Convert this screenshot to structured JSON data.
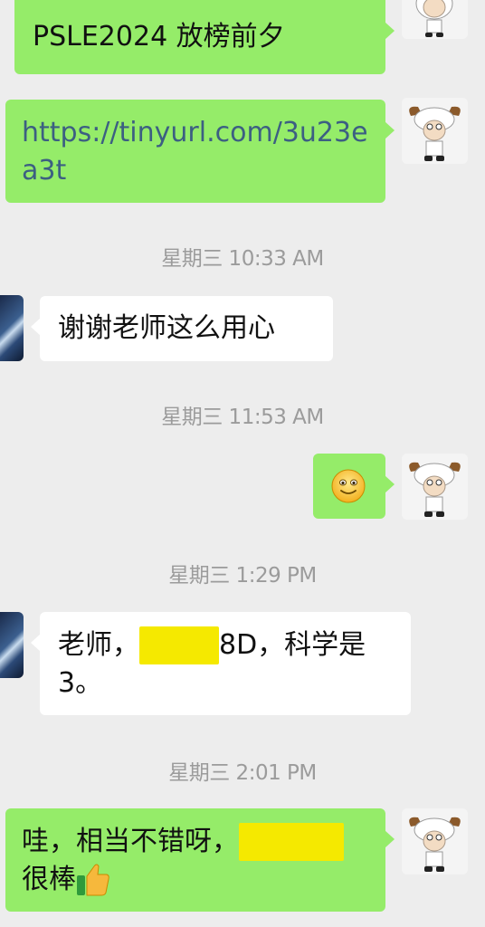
{
  "messages": [
    {
      "id": "m1",
      "text_visible": "PSLE2024 放榜前夕"
    },
    {
      "id": "m2",
      "link_line1": "https://tinyurl.com/3u23e",
      "link_line2": "a3t"
    },
    {
      "id": "t1",
      "timestamp": "星期三 10:33 AM"
    },
    {
      "id": "m3",
      "text": "谢谢老师这么用心"
    },
    {
      "id": "t2",
      "timestamp": "星期三 11:53 AM"
    },
    {
      "id": "m4",
      "emoji": "smiling-face-icon"
    },
    {
      "id": "t3",
      "timestamp": "星期三 1:29 PM"
    },
    {
      "id": "m5",
      "text_part1": "老师，",
      "text_part2": "8D，科学是",
      "text_line2": "3。"
    },
    {
      "id": "t4",
      "timestamp": "星期三 2:01 PM"
    },
    {
      "id": "m6",
      "text_part1": "哇，相当不错呀，",
      "text_line2": "很棒"
    }
  ],
  "colors": {
    "outgoing_bubble": "#95ec69",
    "incoming_bubble": "#ffffff",
    "background": "#ededed",
    "link": "#3c5f82",
    "timestamp": "#9b9b9b",
    "redaction": "#f5e900"
  }
}
